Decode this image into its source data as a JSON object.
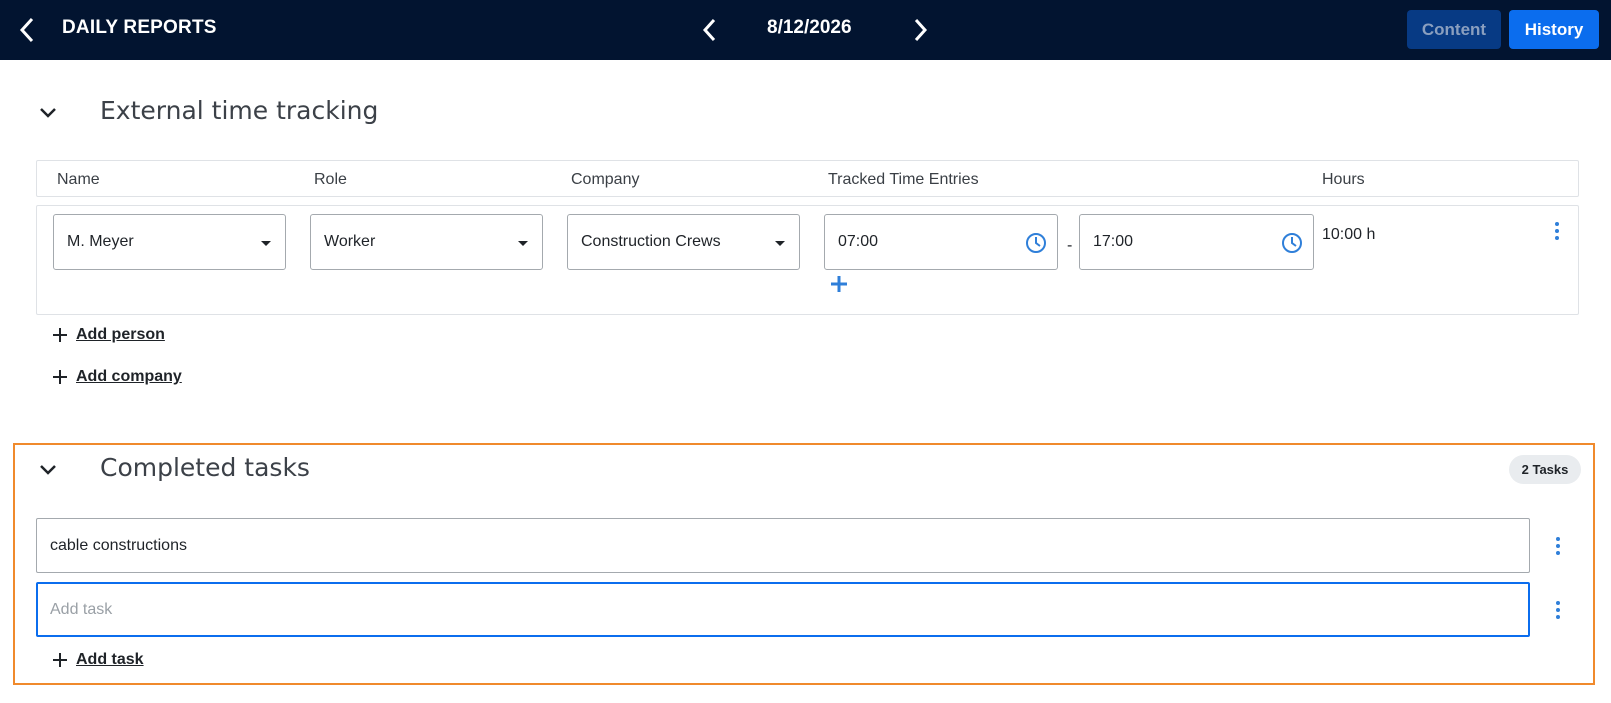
{
  "header": {
    "title": "DAILY REPORTS",
    "date": "8/12/2026",
    "content_button": "Content",
    "history_button": "History"
  },
  "time_tracking": {
    "title": "External time tracking",
    "columns": [
      "Name",
      "Role",
      "Company",
      "Tracked Time Entries",
      "Hours"
    ],
    "rows": [
      {
        "name": "M. Meyer",
        "role": "Worker",
        "company": "Construction Crews",
        "start": "07:00",
        "separator": "-",
        "end": "17:00",
        "hours": "10:00 h"
      }
    ],
    "add_person": "Add person",
    "add_company": "Add company"
  },
  "completed_tasks": {
    "title": "Completed tasks",
    "badge": "2 Tasks",
    "tasks": [
      {
        "value": "cable constructions"
      }
    ],
    "new_task_placeholder": "Add task",
    "add_task": "Add task"
  },
  "colors": {
    "topbar": "#021430",
    "primary": "#0b6dee",
    "highlight_border": "#f08a2c"
  },
  "icons": {
    "back": "chevron-left-icon",
    "prev_date": "chevron-left-icon",
    "next_date": "chevron-right-icon",
    "collapse": "chevron-down-icon",
    "clock": "clock-icon",
    "more": "kebab-menu-icon",
    "add": "plus-icon"
  }
}
